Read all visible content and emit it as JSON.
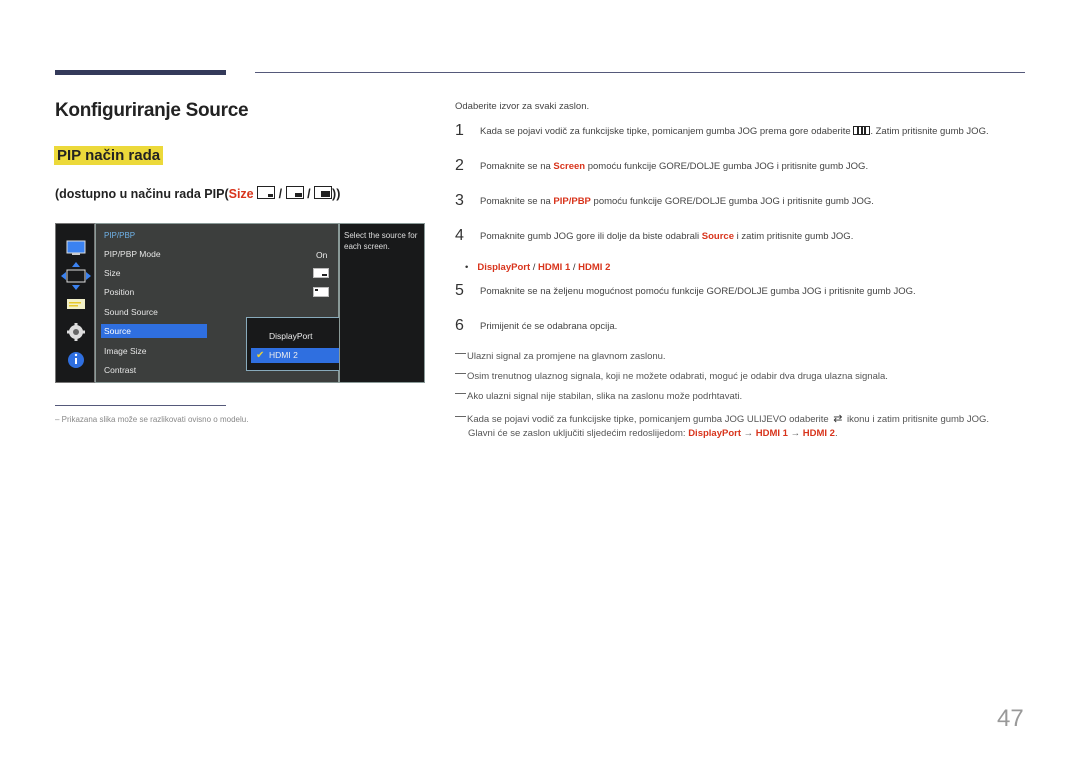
{
  "header": {
    "title": "Konfiguriranje Source",
    "subtitle": "PIP način rada",
    "availability": {
      "prefix": "(dostupno u načinu rada PIP(",
      "size_label": "Size",
      "sep": "/",
      "suffix": "))"
    }
  },
  "osd": {
    "sidebar_icons": [
      "monitor-icon",
      "move-arrows-icon",
      "picture-icon",
      "gear-icon",
      "info-icon"
    ],
    "menu_heading": "PIP/PBP",
    "menu_items": [
      {
        "label": "PIP/PBP Mode",
        "value": "On"
      },
      {
        "label": "Size",
        "value": "size-small-icon"
      },
      {
        "label": "Position",
        "value": "position-icon"
      },
      {
        "label": "Sound Source",
        "value": ""
      },
      {
        "label": "Source",
        "value": "",
        "selected": true
      },
      {
        "label": "Image Size",
        "value": ""
      },
      {
        "label": "Contrast",
        "value": ""
      }
    ],
    "submenu": [
      {
        "label": "DisplayPort",
        "selected": false
      },
      {
        "label": "HDMI 2",
        "selected": true
      }
    ],
    "help_text": "Select the source for each screen."
  },
  "content": {
    "intro": "Odaberite izvor za svaki zaslon.",
    "steps": [
      {
        "num": "1",
        "parts": [
          {
            "t": "Kada se pojavi vodič za funkcijske tipke, pomicanjem gumba JOG prema gore odaberite "
          },
          {
            "icon": "menu-icon"
          },
          {
            "t": ". Zatim pritisnite gumb JOG."
          }
        ]
      },
      {
        "num": "2",
        "parts": [
          {
            "t": "Pomaknite se na "
          },
          {
            "b": "Screen"
          },
          {
            "t": " pomoću funkcije GORE/DOLJE gumba JOG i pritisnite gumb JOG."
          }
        ]
      },
      {
        "num": "3",
        "parts": [
          {
            "t": "Pomaknite se na "
          },
          {
            "b": "PIP/PBP"
          },
          {
            "t": " pomoću funkcije GORE/DOLJE gumba JOG i pritisnite gumb JOG."
          }
        ]
      },
      {
        "num": "4",
        "parts": [
          {
            "t": "Pomaknite gumb JOG gore ili dolje da biste odabrali "
          },
          {
            "b": "Source"
          },
          {
            "t": " i zatim pritisnite gumb JOG."
          }
        ]
      },
      {
        "num": "5",
        "parts": [
          {
            "t": "Pomaknite se na željenu mogućnost pomoću funkcije GORE/DOLJE gumba JOG i pritisnite gumb JOG."
          }
        ]
      },
      {
        "num": "6",
        "parts": [
          {
            "t": "Primijenit će se odabrana opcija."
          }
        ]
      }
    ],
    "options_bullet": {
      "opt1": "DisplayPort",
      "sep": " / ",
      "opt2": "HDMI 1",
      "opt3": "HDMI 2"
    },
    "notes": [
      "Ulazni signal za promjene na glavnom zaslonu.",
      "Osim trenutnog ulaznog signala, koji ne možete odabrati, moguć je odabir dva druga ulazna signala.",
      "Ako ulazni signal nije stabilan, slika na zaslonu može podrhtavati."
    ],
    "last_note": {
      "line1_a": "Kada se pojavi vodič za funkcijske tipke, pomicanjem gumba JOG ULIJEVO odaberite ",
      "line1_b": " ikonu i zatim pritisnite gumb JOG.",
      "line2": "Glavni će se zaslon uključiti sljedećim redoslijedom: ",
      "seq1": "DisplayPort",
      "arrow": " → ",
      "seq2": "HDMI 1",
      "seq3": "HDMI 2",
      "end": "."
    }
  },
  "footnote": "Prikazana slika može se razlikovati ovisno o modelu.",
  "page_number": "47",
  "colors": {
    "accent_red": "#d8341c",
    "highlight_yellow": "#ecd93a",
    "osd_select_blue": "#2f6fe0",
    "rule_navy": "#343a5a"
  }
}
